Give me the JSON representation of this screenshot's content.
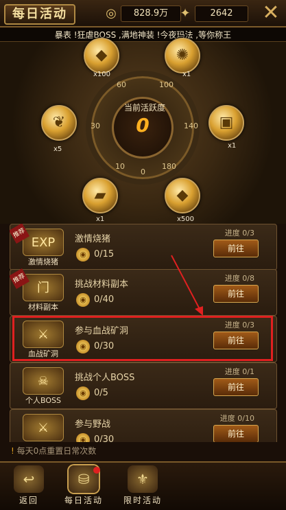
{
  "header": {
    "title": "每日活动",
    "currency1_value": "828.9万",
    "currency2_value": "2642",
    "close_icon": "close-icon"
  },
  "marquee": "暴表 !狂虐BOSS ,满地神装 !今夜玛法 ,等你称王",
  "dial": {
    "center_label": "当前活跃度",
    "center_value": "0",
    "ticks": [
      "60",
      "100",
      "30",
      "140",
      "10",
      "0",
      "180"
    ],
    "rewards": [
      {
        "icon": "gold-ingot-icon",
        "count": "x100"
      },
      {
        "icon": "fire-orb-icon",
        "count": "x1"
      },
      {
        "icon": "feather-icon",
        "count": "x5"
      },
      {
        "icon": "treasure-icon",
        "count": "x1"
      },
      {
        "icon": "gold-bar-icon",
        "count": "x1"
      },
      {
        "icon": "gold-ingot-icon",
        "count": "x500"
      }
    ]
  },
  "activities": [
    {
      "name": "激情烧猪",
      "icon_label": "激情烧猪",
      "icon_text": "EXP",
      "value": "0/15",
      "progress": "进度 0/3",
      "button": "前往",
      "tag": "推荐"
    },
    {
      "name": "挑战材料副本",
      "icon_label": "材料副本",
      "icon_text": "门",
      "value": "0/40",
      "progress": "进度 0/8",
      "button": "前往",
      "tag": "推荐"
    },
    {
      "name": "参与血战矿洞",
      "icon_label": "血战矿洞",
      "icon_text": "⚔",
      "value": "0/30",
      "progress": "进度 0/3",
      "button": "前往",
      "tag": ""
    },
    {
      "name": "挑战个人BOSS",
      "icon_label": "个人BOSS",
      "icon_text": "☠",
      "value": "0/5",
      "progress": "进度 0/1",
      "button": "前往",
      "tag": ""
    },
    {
      "name": "参与野战",
      "icon_label": "野战",
      "icon_text": "⚔",
      "value": "0/30",
      "progress": "进度 0/10",
      "button": "前往",
      "tag": ""
    }
  ],
  "footer_note": "每天0点重置日常次数",
  "tabs": [
    {
      "label": "返回",
      "icon": "back-arrow-icon"
    },
    {
      "label": "每日活动",
      "icon": "daily-activity-icon"
    },
    {
      "label": "限时活动",
      "icon": "limited-activity-icon"
    }
  ],
  "colors": {
    "accent": "#ffb020",
    "highlight": "#e02020"
  }
}
